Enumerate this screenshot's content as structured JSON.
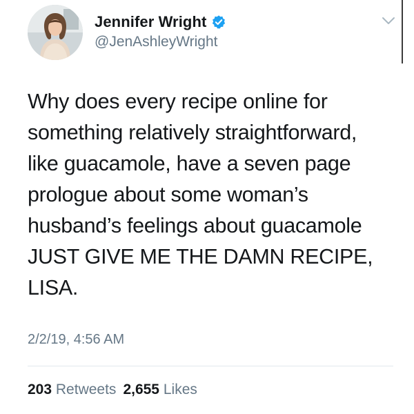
{
  "user": {
    "display_name": "Jennifer Wright",
    "handle": "@JenAshleyWright",
    "verified": true,
    "verified_color": "#1da1f2"
  },
  "icons": {
    "avatar": "profile-photo",
    "verified": "verified-badge-icon",
    "menu": "chevron-down-icon"
  },
  "tweet": {
    "lines": [
      "Why does every recipe online for",
      "something relatively straightforward,",
      "like guacamole, have a seven page",
      "prologue about some woman’s",
      "husband’s feelings about guacamole",
      "JUST GIVE ME THE DAMN RECIPE,",
      "LISA."
    ],
    "timestamp": "2/2/19, 4:56 AM"
  },
  "stats": {
    "retweets_count": "203",
    "retweets_label": "Retweets",
    "likes_count": "2,655",
    "likes_label": "Likes"
  },
  "colors": {
    "text": "#14171a",
    "secondary": "#657786",
    "divider": "#e1e8ed"
  }
}
